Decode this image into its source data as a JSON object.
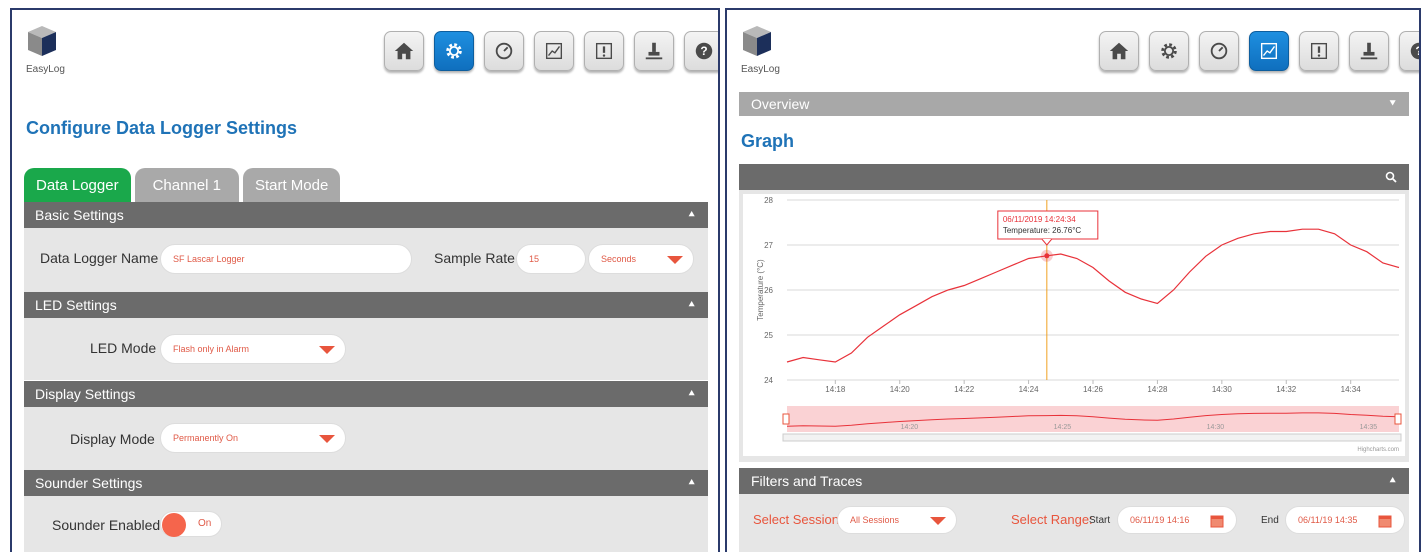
{
  "left": {
    "logo_text": "EasyLog",
    "page_title": "Configure Data Logger Settings",
    "tabs": [
      "Data Logger",
      "Channel 1",
      "Start Mode"
    ],
    "sections": {
      "basic": "Basic Settings",
      "led": "LED Settings",
      "display": "Display Settings",
      "sounder": "Sounder Settings"
    },
    "basic": {
      "name_label": "Data Logger Name",
      "name_value": "SF Lascar Logger",
      "rate_label": "Sample Rate",
      "rate_value": "15",
      "rate_unit": "Seconds"
    },
    "led": {
      "label": "LED Mode",
      "value": "Flash only in Alarm"
    },
    "display": {
      "label": "Display Mode",
      "value": "Permanently On"
    },
    "sounder": {
      "label": "Sounder Enabled",
      "value": "On"
    }
  },
  "right": {
    "logo_text": "EasyLog",
    "overview": "Overview",
    "page_title": "Graph",
    "filters_title": "Filters and Traces",
    "select_session_label": "Select Session:",
    "session_value": "All Sessions",
    "select_range_label": "Select Range:",
    "start_label": "Start",
    "start_value": "06/11/19 14:16",
    "end_label": "End",
    "end_value": "06/11/19 14:35",
    "highcharts": "Highcharts.com"
  },
  "icons": [
    "home-icon",
    "gear-icon",
    "gauge-icon",
    "graph-icon",
    "alarm-icon",
    "download-icon",
    "help-icon"
  ],
  "colors": {
    "accent_blue": "#1f73b7",
    "active_tab": "#1aa84b",
    "line": "#e8323a",
    "crosshair": "#f0a020"
  },
  "chart_data": {
    "type": "line",
    "ylabel": "Temperature (°C)",
    "ylim": [
      24,
      28
    ],
    "yticks": [
      "24",
      "25",
      "26",
      "27",
      "28"
    ],
    "xticks": [
      "14:18",
      "14:20",
      "14:22",
      "14:24",
      "14:26",
      "14:28",
      "14:30",
      "14:32",
      "14:34"
    ],
    "navigator_ticks": [
      "14:20",
      "14:25",
      "14:30",
      "14:35"
    ],
    "series": [
      {
        "x": [
          "14:16:30",
          "14:17:00",
          "14:17:30",
          "14:18:00",
          "14:18:30",
          "14:19:00",
          "14:19:30",
          "14:20:00",
          "14:20:30",
          "14:21:00",
          "14:21:30",
          "14:22:00",
          "14:22:30",
          "14:23:00",
          "14:23:30",
          "14:24:00",
          "14:24:34",
          "14:25:00",
          "14:25:30",
          "14:26:00",
          "14:26:30",
          "14:27:00",
          "14:27:30",
          "14:28:00",
          "14:28:30",
          "14:29:00",
          "14:29:30",
          "14:30:00",
          "14:30:30",
          "14:31:00",
          "14:31:30",
          "14:32:00",
          "14:32:30",
          "14:33:00",
          "14:33:30",
          "14:34:00",
          "14:34:30",
          "14:35:00",
          "14:35:30"
        ],
        "values": [
          24.4,
          24.5,
          24.45,
          24.4,
          24.6,
          24.95,
          25.2,
          25.45,
          25.65,
          25.85,
          26.0,
          26.1,
          26.25,
          26.4,
          26.55,
          26.7,
          26.76,
          26.8,
          26.7,
          26.5,
          26.2,
          25.95,
          25.8,
          25.7,
          26.0,
          26.4,
          26.75,
          27.0,
          27.15,
          27.25,
          27.3,
          27.3,
          27.35,
          27.35,
          27.25,
          27.0,
          26.85,
          26.6,
          26.5
        ]
      }
    ],
    "tooltip": {
      "date": "06/11/2019 14:24:34",
      "text": "Temperature: 26.76°C",
      "x": "14:24:34",
      "y": 26.76
    }
  }
}
